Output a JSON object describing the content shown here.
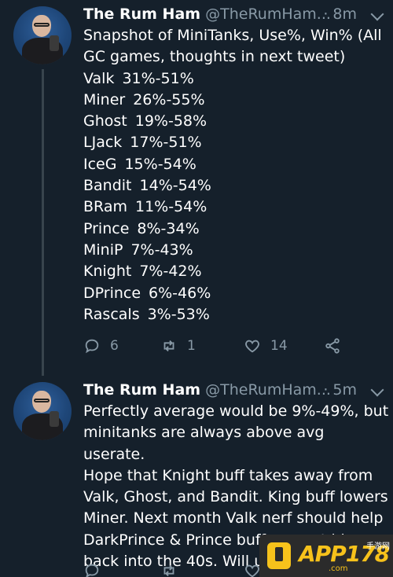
{
  "colors": {
    "background": "#15202b",
    "text": "#ffffff",
    "secondary": "#8899a6"
  },
  "tweets": [
    {
      "name": "The Rum Ham",
      "handle": "@TheRumHam...",
      "time": "· 8m",
      "text": "Snapshot of MiniTanks, Use%, Win% (All GC games, thoughts in next tweet)",
      "stats": [
        {
          "card": "Valk",
          "value": "31%-51%"
        },
        {
          "card": "Miner",
          "value": "26%-55%"
        },
        {
          "card": "Ghost",
          "value": "19%-58%"
        },
        {
          "card": "LJack",
          "value": "17%-51%"
        },
        {
          "card": "IceG",
          "value": "15%-54%"
        },
        {
          "card": "Bandit",
          "value": "14%-54%"
        },
        {
          "card": "BRam",
          "value": "11%-54%"
        },
        {
          "card": "Prince",
          "value": "8%-34%"
        },
        {
          "card": "MiniP",
          "value": "7%-43%"
        },
        {
          "card": "Knight",
          "value": "7%-42%"
        },
        {
          "card": "DPrince",
          "value": "6%-46%"
        },
        {
          "card": "Rascals",
          "value": "3%-53%"
        }
      ],
      "actions": {
        "replies": "6",
        "retweets": "1",
        "likes": "14"
      }
    },
    {
      "name": "The Rum Ham",
      "handle": "@TheRumHam...",
      "time": "· 5m",
      "lines": [
        "Perfectly average would be 9%-49%, but",
        "minitanks are always above avg userate.",
        "Hope that Knight buff takes away from",
        "Valk, Ghost, and Bandit. King buff lowers",
        "Miner. Next month Valk nerf should help",
        "DarkPrince & Prince buff can get him",
        "back into the 40s. Will up"
      ]
    }
  ],
  "watermark": {
    "brand": "APP178",
    "brand_suffix": "手游网",
    "domain": ".com"
  },
  "icons": [
    "reply-icon",
    "retweet-icon",
    "like-icon",
    "share-icon",
    "chevron-down-icon"
  ]
}
